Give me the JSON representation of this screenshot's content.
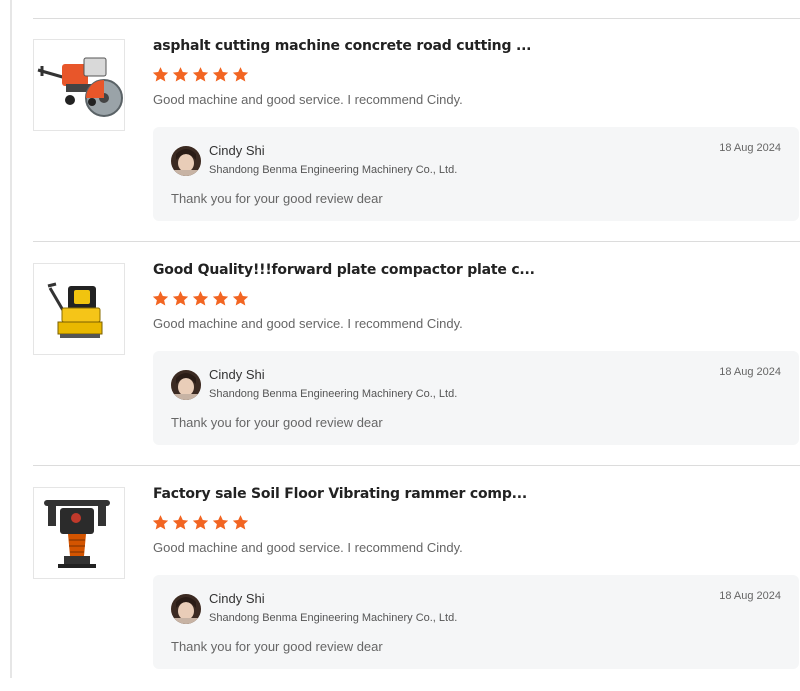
{
  "colors": {
    "star": "#f26522",
    "divider": "#dcdcdc",
    "reply_bg": "#f5f6f7"
  },
  "reviews": [
    {
      "product_title": "asphalt cutting machine concrete road cutting ...",
      "rating": 5,
      "comment": "Good machine and good service. I recommend Cindy.",
      "product_icon": "concrete-cutter-image",
      "reply": {
        "name": "Cindy Shi",
        "company": "Shandong Benma Engineering Machinery Co., Ltd.",
        "date": "18 Aug 2024",
        "text": "Thank you for your good review dear"
      }
    },
    {
      "product_title": "Good Quality!!!forward plate compactor plate c...",
      "rating": 5,
      "comment": "Good machine and good service. I recommend Cindy.",
      "product_icon": "plate-compactor-image",
      "reply": {
        "name": "Cindy Shi",
        "company": "Shandong Benma Engineering Machinery Co., Ltd.",
        "date": "18 Aug 2024",
        "text": "Thank you for your good review dear"
      }
    },
    {
      "product_title": "Factory sale Soil Floor Vibrating rammer comp...",
      "rating": 5,
      "comment": "Good machine and good service. I recommend Cindy.",
      "product_icon": "tamping-rammer-image",
      "reply": {
        "name": "Cindy Shi",
        "company": "Shandong Benma Engineering Machinery Co., Ltd.",
        "date": "18 Aug 2024",
        "text": "Thank you for your good review dear"
      }
    }
  ]
}
